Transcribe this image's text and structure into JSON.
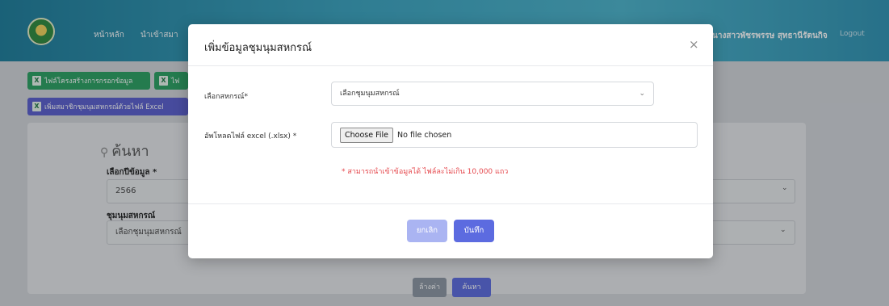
{
  "header": {
    "nav": [
      "หน้าหลัก",
      "นำเข้าสมา"
    ],
    "user_name": "นางสาวพัชรพรรษ สุทธานีรัตนกิจ",
    "logout": "Logout"
  },
  "toolbar": {
    "btn1": "ไฟล์โครงสร้างการกรอกข้อมูล",
    "btn2": "ไฟ",
    "btn3": "เพิ่มสมาชิกชุมนุมสหกรณ์ด้วยไฟล์ Excel",
    "xls_glyph": "X"
  },
  "search": {
    "title": "ค้นหา",
    "year_label": "เลือกปีข้อมูล *",
    "year_value": "2566",
    "coop_label": "ชุมนุมสหกรณ์",
    "coop_value": "เลือกชุมนุมสหกรณ์",
    "reset": "ล้างค่า",
    "search": "ค้นหา"
  },
  "modal": {
    "title": "เพิ่มข้อมูลชุมนุมสหกรณ์",
    "close": "×",
    "coop_label": "เลือกสหกรณ์*",
    "coop_placeholder": "เลือกชุมนุมสหกรณ์",
    "file_label": "อัพโหลดไฟล์ excel (.xlsx) *",
    "choose_file": "Choose File",
    "no_file": "No file chosen",
    "warning": "* สามารถนำเข้าข้อมูลได้ ไฟล์ละไม่เกิน 10,000 แถว",
    "cancel": "ยกเลิก",
    "save": "บันทึก"
  },
  "icons": {
    "chevron": "⌄",
    "search": "⚲"
  },
  "colors": {
    "green": "#2aa162",
    "purple": "#5a5fcf",
    "primary": "#5c6be0",
    "warning": "#e5484d"
  }
}
